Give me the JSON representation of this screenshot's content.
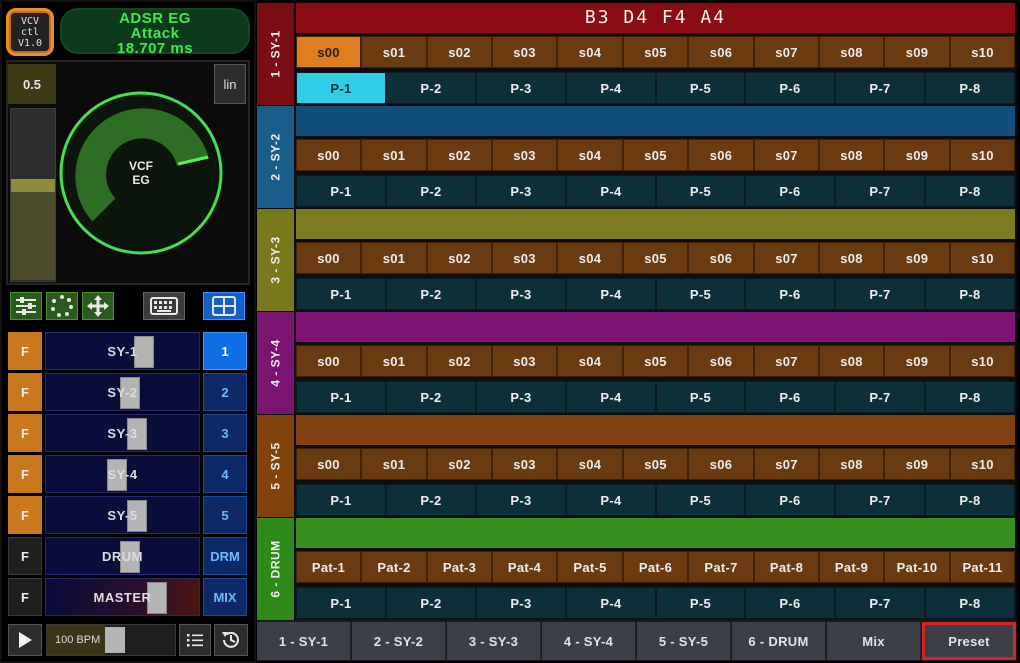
{
  "header": {
    "logo_lines": [
      "VCV",
      "ctl",
      "V1.0"
    ],
    "title_lines": [
      "ADSR EG",
      "Attack",
      "18.707 ms"
    ]
  },
  "control": {
    "value": "0.5",
    "scale_label": "lin",
    "knob_label_lines": [
      "VCF",
      "EG"
    ],
    "slider_level": 0.55,
    "knob_level": 0.8
  },
  "icon_bar": [
    {
      "icon": "sliders-icon",
      "active": false
    },
    {
      "icon": "dots-circle-icon",
      "active": false
    },
    {
      "icon": "move-arrows-icon",
      "active": false
    },
    {
      "icon": "keyboard-icon",
      "active": false
    },
    {
      "icon": "grid-icon",
      "active": true
    }
  ],
  "channels": [
    {
      "f": "F",
      "f_on": true,
      "name": "SY-1",
      "fader": 0.65,
      "sel": "1",
      "sel_active": true
    },
    {
      "f": "F",
      "f_on": true,
      "name": "SY-2",
      "fader": 0.55,
      "sel": "2",
      "sel_active": false
    },
    {
      "f": "F",
      "f_on": true,
      "name": "SY-3",
      "fader": 0.6,
      "sel": "3",
      "sel_active": false
    },
    {
      "f": "F",
      "f_on": true,
      "name": "SY-4",
      "fader": 0.45,
      "sel": "4",
      "sel_active": false
    },
    {
      "f": "F",
      "f_on": true,
      "name": "SY-5",
      "fader": 0.6,
      "sel": "5",
      "sel_active": false
    },
    {
      "f": "F",
      "f_on": false,
      "name": "DRUM",
      "fader": 0.55,
      "sel": "DRM",
      "sel_active": false
    },
    {
      "f": "F",
      "f_on": false,
      "name": "MASTER",
      "fader": 0.75,
      "sel": "MIX",
      "sel_active": false
    }
  ],
  "transport": {
    "play_icon": "play-icon",
    "bpm_label": "100 BPM",
    "bpm_level": 0.45,
    "list_icon": "list-icon",
    "history_icon": "history-icon"
  },
  "chord": "B3  D4  F4  A4",
  "sections": [
    {
      "label": "1 - SY-1",
      "color": "#7b0e14",
      "head_color": "#8b0c12",
      "rows_s": [
        "s00",
        "s01",
        "s02",
        "s03",
        "s04",
        "s05",
        "s06",
        "s07",
        "s08",
        "s09",
        "s10"
      ],
      "s_active": 0,
      "rows_p": [
        "P-1",
        "P-2",
        "P-3",
        "P-4",
        "P-5",
        "P-6",
        "P-7",
        "P-8"
      ],
      "p_active": 0
    },
    {
      "label": "2 - SY-2",
      "color": "#1a5c8a",
      "head_color": "#124e7c",
      "rows_s": [
        "s00",
        "s01",
        "s02",
        "s03",
        "s04",
        "s05",
        "s06",
        "s07",
        "s08",
        "s09",
        "s10"
      ],
      "s_active": -1,
      "rows_p": [
        "P-1",
        "P-2",
        "P-3",
        "P-4",
        "P-5",
        "P-6",
        "P-7",
        "P-8"
      ],
      "p_active": -1
    },
    {
      "label": "3 - SY-3",
      "color": "#79781b",
      "head_color": "#7d7b21",
      "rows_s": [
        "s00",
        "s01",
        "s02",
        "s03",
        "s04",
        "s05",
        "s06",
        "s07",
        "s08",
        "s09",
        "s10"
      ],
      "s_active": -1,
      "rows_p": [
        "P-1",
        "P-2",
        "P-3",
        "P-4",
        "P-5",
        "P-6",
        "P-7",
        "P-8"
      ],
      "p_active": -1
    },
    {
      "label": "4 - SY-4",
      "color": "#7a1470",
      "head_color": "#7e1473",
      "rows_s": [
        "s00",
        "s01",
        "s02",
        "s03",
        "s04",
        "s05",
        "s06",
        "s07",
        "s08",
        "s09",
        "s10"
      ],
      "s_active": -1,
      "rows_p": [
        "P-1",
        "P-2",
        "P-3",
        "P-4",
        "P-5",
        "P-6",
        "P-7",
        "P-8"
      ],
      "p_active": -1
    },
    {
      "label": "5 - SY-5",
      "color": "#82420e",
      "head_color": "#80400f",
      "rows_s": [
        "s00",
        "s01",
        "s02",
        "s03",
        "s04",
        "s05",
        "s06",
        "s07",
        "s08",
        "s09",
        "s10"
      ],
      "s_active": -1,
      "rows_p": [
        "P-1",
        "P-2",
        "P-3",
        "P-4",
        "P-5",
        "P-6",
        "P-7",
        "P-8"
      ],
      "p_active": -1
    },
    {
      "label": "6 - DRUM",
      "color": "#2f8a1a",
      "head_color": "#368f1f",
      "rows_s": [
        "Pat-1",
        "Pat-2",
        "Pat-3",
        "Pat-4",
        "Pat-5",
        "Pat-6",
        "Pat-7",
        "Pat-8",
        "Pat-9",
        "Pat-10",
        "Pat-11"
      ],
      "s_active": -1,
      "rows_p": [
        "P-1",
        "P-2",
        "P-3",
        "P-4",
        "P-5",
        "P-6",
        "P-7",
        "P-8"
      ],
      "p_active": -1
    }
  ],
  "tabs": [
    {
      "label": "1 - SY-1",
      "selected": false
    },
    {
      "label": "2 - SY-2",
      "selected": false
    },
    {
      "label": "3 - SY-3",
      "selected": false
    },
    {
      "label": "4 - SY-4",
      "selected": false
    },
    {
      "label": "5 - SY-5",
      "selected": false
    },
    {
      "label": "6 - DRUM",
      "selected": false
    },
    {
      "label": "Mix",
      "selected": false
    },
    {
      "label": "Preset",
      "selected": true
    }
  ]
}
